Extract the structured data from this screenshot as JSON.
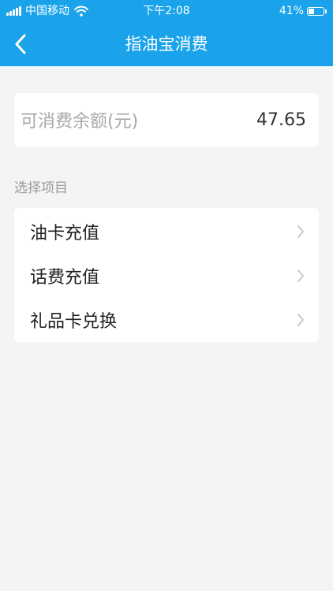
{
  "status_bar": {
    "carrier": "中国移动",
    "time": "下午2:08",
    "battery_percent_text": "41%",
    "battery_level": 0.41
  },
  "nav": {
    "back_icon": "chevron-left-icon",
    "title": "指油宝消费"
  },
  "balance": {
    "label": "可消费余额(元)",
    "value": "47.65"
  },
  "section": {
    "title": "选择项目"
  },
  "menu": {
    "items": [
      {
        "label": "油卡充值",
        "icon": "chevron-right-icon"
      },
      {
        "label": "话费充值",
        "icon": "chevron-right-icon"
      },
      {
        "label": "礼品卡兑换",
        "icon": "chevron-right-icon"
      }
    ]
  },
  "colors": {
    "header_bg": "#1aa3ea",
    "page_bg": "#f3f4f6",
    "card_bg": "#ffffff",
    "muted_text": "#a8a8a8",
    "chevron": "#c4c4c4"
  }
}
